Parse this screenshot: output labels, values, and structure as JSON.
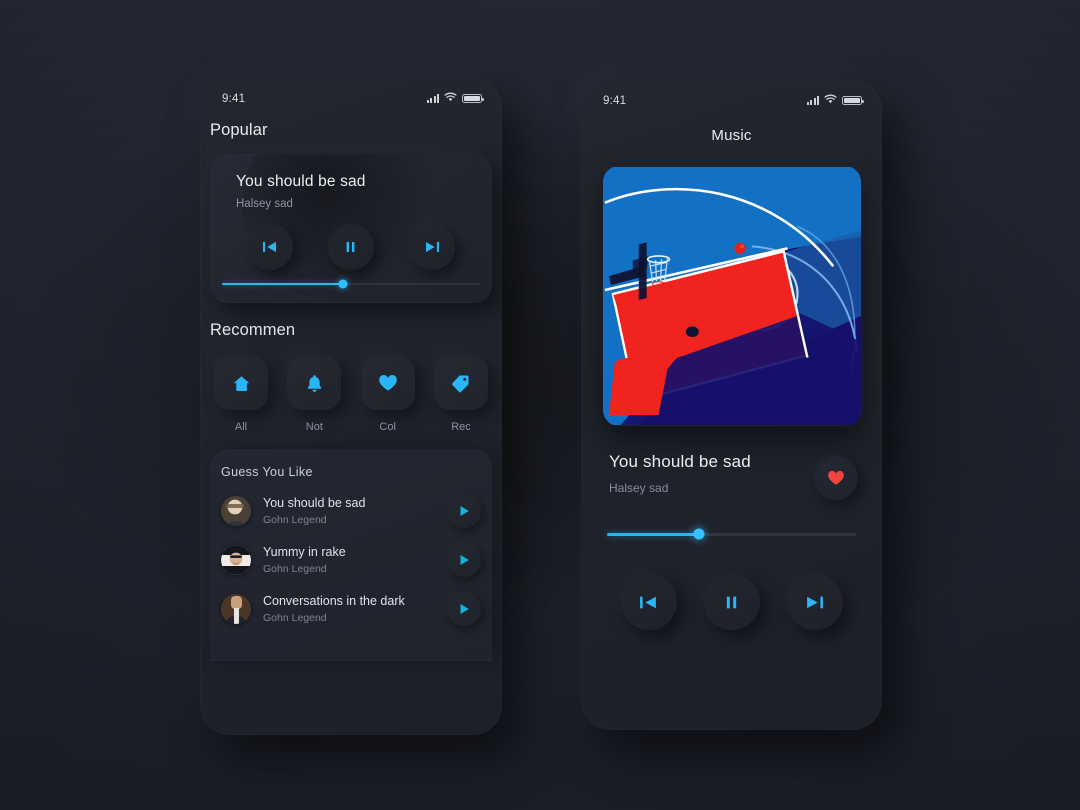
{
  "theme": {
    "background": "#23262f",
    "accent": "#29b6f6",
    "heart_color": "#f2453d",
    "text_primary": "#e9edf3",
    "text_secondary": "#868d9b"
  },
  "left_phone": {
    "status_bar": {
      "time": "9:41",
      "signal_icon": "signal-bars-icon",
      "wifi_icon": "wifi-icon",
      "battery_icon": "battery-icon"
    },
    "header": {
      "title": "Popular"
    },
    "player_card": {
      "title": "You should be sad",
      "artist": "Halsey sad",
      "controls": {
        "previous": "previous-icon",
        "play_pause": "pause-icon",
        "next": "next-icon"
      },
      "progress_percent": 47
    },
    "recommend": {
      "title": "Recommen",
      "chips": [
        {
          "icon": "home-icon",
          "label": "All"
        },
        {
          "icon": "bell-icon",
          "label": "Not"
        },
        {
          "icon": "heart-icon",
          "label": "Col"
        },
        {
          "icon": "tag-icon",
          "label": "Rec"
        }
      ]
    },
    "guess_you_like": {
      "title": "Guess You Like",
      "tracks": [
        {
          "name": "You should be sad",
          "artist": "Gohn Legend",
          "action": "play-icon"
        },
        {
          "name": "Yummy in rake",
          "artist": "Gohn Legend",
          "action": "play-icon"
        },
        {
          "name": "Conversations in the dark",
          "artist": "Gohn Legend",
          "action": "play-icon"
        }
      ]
    }
  },
  "right_phone": {
    "status_bar": {
      "time": "9:41",
      "signal_icon": "signal-bars-icon",
      "wifi_icon": "wifi-icon",
      "battery_icon": "battery-icon"
    },
    "header": {
      "title": "Music"
    },
    "album_art": {
      "description": "basketball-court-illustration",
      "colors": {
        "court_blue": "#1271c4",
        "court_dark_blue": "#15106b",
        "paint_red": "#f0231f",
        "line_white": "#ffffff"
      }
    },
    "now_playing": {
      "title": "You should be sad",
      "artist": "Halsey sad",
      "favorite_icon": "heart-icon",
      "favorited": true,
      "progress_percent": 37
    },
    "controls": {
      "previous": "previous-icon",
      "play_pause": "pause-icon",
      "next": "next-icon"
    }
  }
}
